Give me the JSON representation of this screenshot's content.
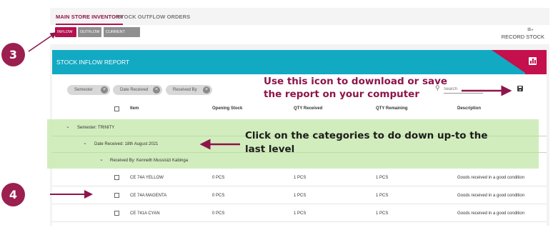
{
  "tabs": [
    "MAIN STORE INVENTORY",
    "STOCK OUTFLOW ORDERS"
  ],
  "chips": [
    "INFLOW",
    "OUTFLOW",
    "CURRENT STOCK"
  ],
  "record_stock": {
    "label": "RECORD STOCK",
    "icon": "playlist-add-icon"
  },
  "report": {
    "title": "STOCK INFLOW REPORT",
    "chart_icon": "bar-chart-icon",
    "header_color": "#12a9c3",
    "accent": "#c4104d"
  },
  "filters": [
    "Semester",
    "Date Received",
    "Received By"
  ],
  "search": {
    "placeholder": "Search"
  },
  "columns": [
    "Item",
    "Opening Stock",
    "QTY Received",
    "QTY Remaining",
    "Description"
  ],
  "groups": [
    {
      "label": "Semester: TRINITY"
    },
    {
      "label": "Date Received: 18th August 2021"
    },
    {
      "label": "Received By: Kenneth Mussisizi Kabinga"
    }
  ],
  "rows": [
    {
      "item": "CE 74A YELLOW",
      "opening": "0 PCS",
      "received": "1 PCS",
      "remaining": "1 PCS",
      "description": "Goods received in a good condition"
    },
    {
      "item": "CE 74A MAGENTA",
      "opening": "0 PCS",
      "received": "1 PCS",
      "remaining": "1 PCS",
      "description": "Goods received in a good condition"
    },
    {
      "item": "CE 741A CYAN",
      "opening": "0 PCS",
      "received": "1 PCS",
      "remaining": "1 PCS",
      "description": "Goods received in a good condition"
    }
  ],
  "annotations": {
    "download": "Use this icon to download or save the report on your computer",
    "categories": "Click on the categories to do down up-to the last level",
    "step3": "3",
    "step4": "4"
  }
}
